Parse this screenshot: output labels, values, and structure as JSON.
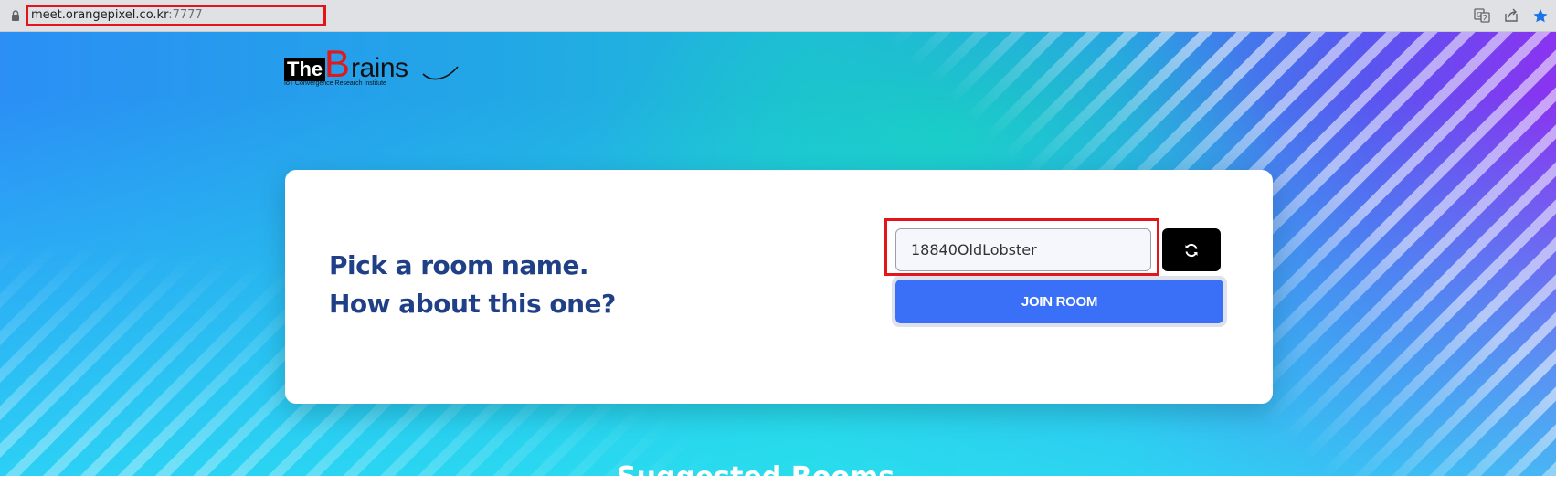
{
  "browser": {
    "url_host": "meet.orangepixel.co.kr",
    "url_port": ":7777",
    "icons": [
      "lock-icon",
      "translate-icon",
      "share-icon",
      "star-icon"
    ]
  },
  "logo": {
    "the": "The",
    "b": "B",
    "rains": "rains",
    "subtitle": "IoT Convergence Research Institute"
  },
  "card": {
    "heading_line1": "Pick a room name.",
    "heading_line2": "How about this one?",
    "room_input_value": "18840OldLobster",
    "refresh_icon": "refresh-icon",
    "join_label": "JOIN ROOM"
  },
  "bottom": {
    "heading_partial": "Suggested Rooms"
  },
  "colors": {
    "highlight": "#e5141b",
    "heading": "#1f3f86",
    "join_button": "#3a70f7",
    "refresh_button": "#000000",
    "logo_red": "#e3171e"
  }
}
